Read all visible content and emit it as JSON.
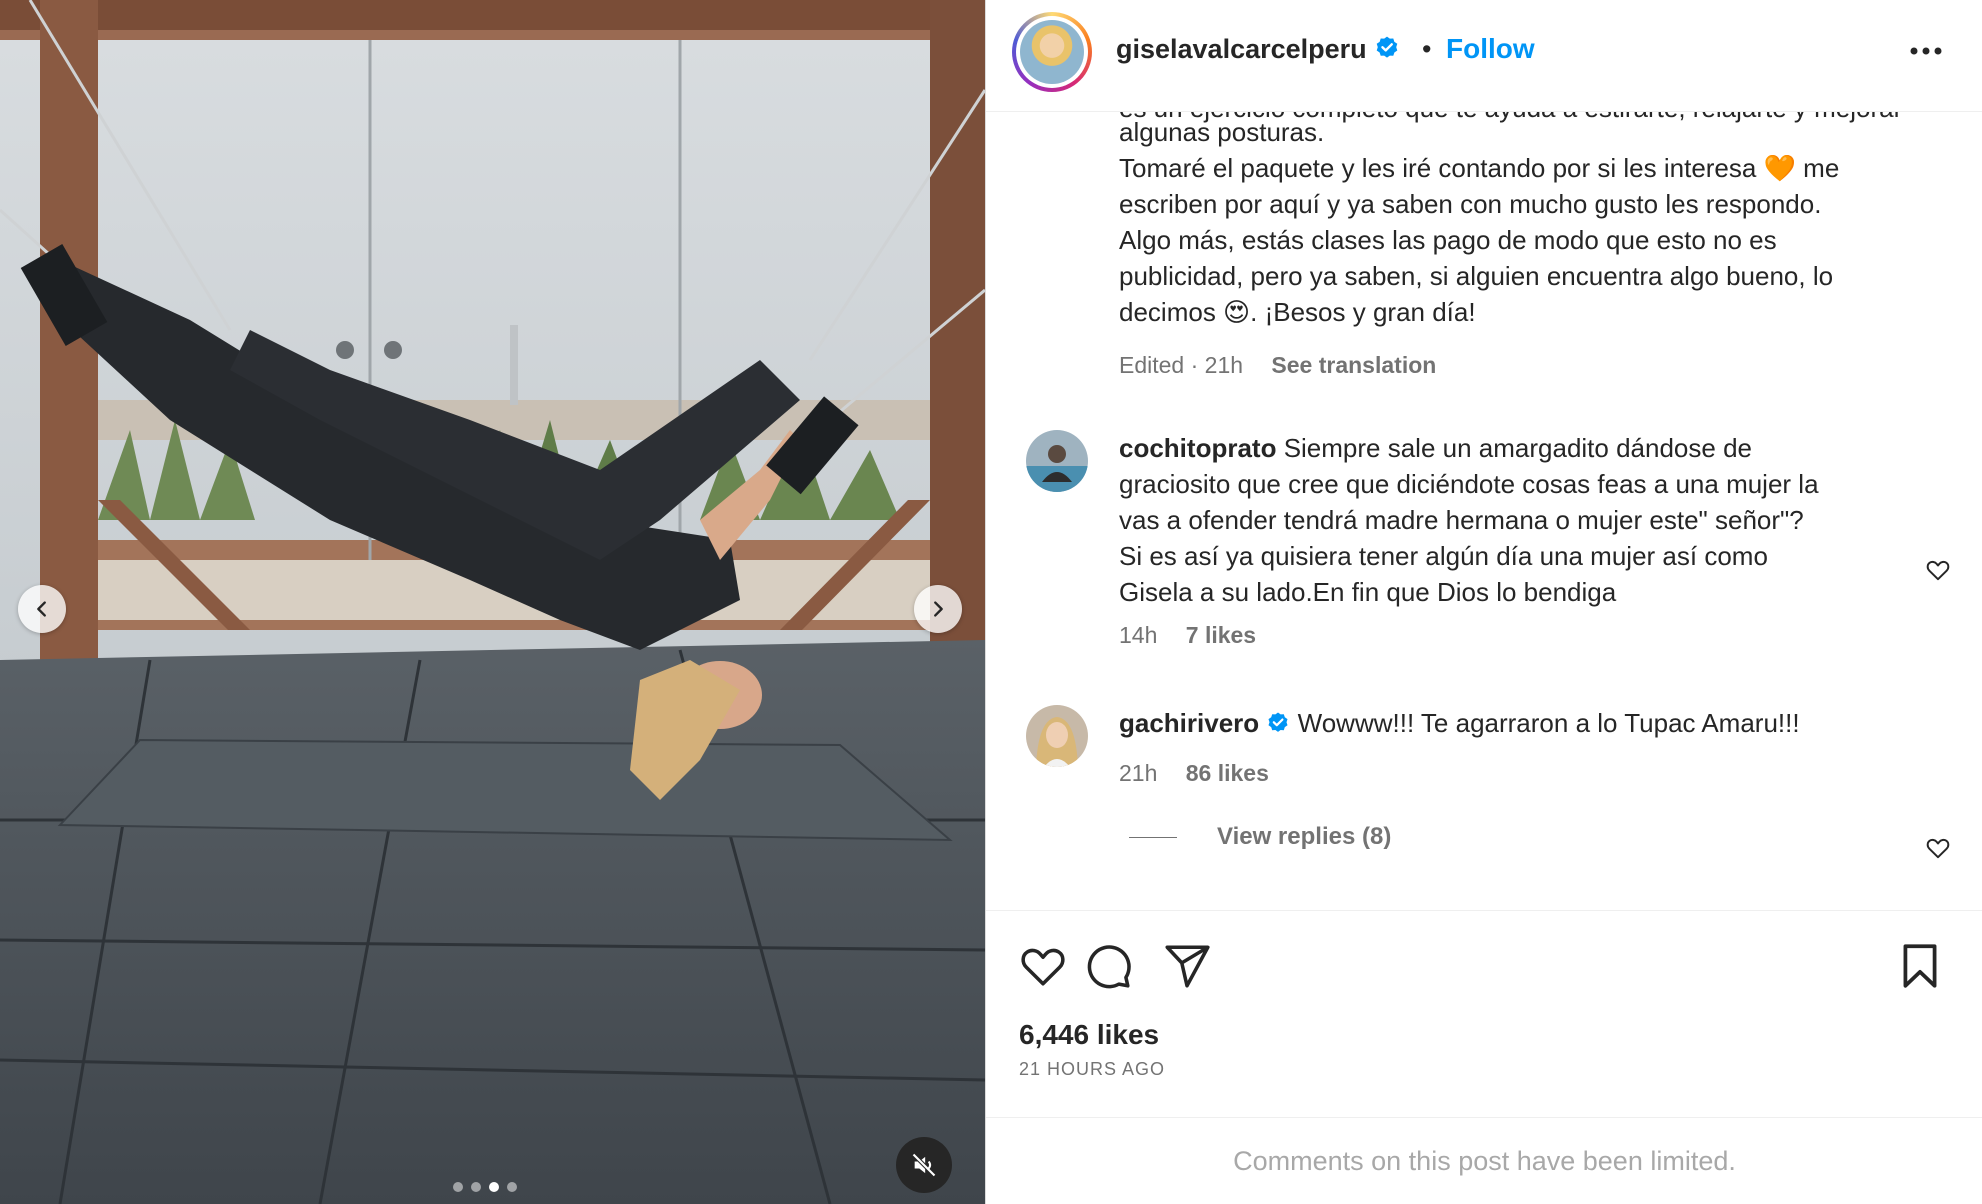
{
  "post": {
    "username": "giselavalcarcelperu",
    "separator": "•",
    "follow_label": "Follow",
    "more_icon": "more-horizontal-icon",
    "verified_color": "#0095f6"
  },
  "media": {
    "prev_icon": "chevron-left-icon",
    "next_icon": "chevron-right-icon",
    "carousel_count": 4,
    "carousel_active_index": 2,
    "mute_icon": "speaker-muted-icon"
  },
  "caption": {
    "clipped_line": "es un ejercicio completo que te ayuda a estirarte, relajarte y mejorar",
    "lines": [
      "algunas posturas.",
      "Tomaré el paquete y les iré contando por si les interesa 🧡 me",
      "escriben por aquí y ya saben con mucho gusto les respondo.",
      "Algo más, estás clases las pago de modo que esto no es",
      "publicidad, pero ya saben, si alguien encuentra algo bueno, lo",
      "decimos 😍. ¡Besos y gran día!"
    ],
    "edited": "Edited · 21h",
    "see_translation": "See translation"
  },
  "comments": [
    {
      "username": "cochitoprato",
      "verified": false,
      "lines": [
        "Siempre sale un amargadito dándose de",
        "graciosito que cree que diciéndote cosas feas a una mujer la",
        "vas a ofender tendrá madre hermana o mujer este\" señor\"?",
        "Si es así ya quisiera tener algún día una mujer así como",
        "Gisela a su lado.En fin que Dios lo bendiga"
      ],
      "time": "14h",
      "likes": "7 likes"
    },
    {
      "username": "gachirivero",
      "verified": true,
      "lines": [
        "Wowww!!! Te agarraron a lo Tupac Amaru!!!"
      ],
      "time": "21h",
      "likes": "86 likes",
      "view_replies": "View replies (8)"
    }
  ],
  "actions": {
    "like_icon": "heart-icon",
    "comment_icon": "comment-bubble-icon",
    "share_icon": "paper-plane-icon",
    "save_icon": "bookmark-icon"
  },
  "likes_total": "6,446 likes",
  "posted_time": "21 HOURS AGO",
  "limited_notice": "Comments on this post have been limited."
}
